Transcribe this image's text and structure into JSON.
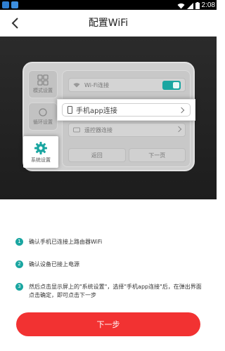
{
  "status_bar": {
    "time": "2:08"
  },
  "header": {
    "title": "配置WiFi"
  },
  "illustration": {
    "tabs": [
      {
        "label": "模式设置",
        "icon": "grid-icon"
      },
      {
        "label": "循环设置",
        "icon": "loop-icon"
      },
      {
        "label": "系统设置",
        "icon": "gear-icon"
      }
    ],
    "menu": [
      {
        "label": "Wi-Fi连接",
        "icon": "wifi-icon"
      },
      {
        "label": "手机app连接",
        "icon": "phone-icon"
      },
      {
        "label": "遥控器连接",
        "icon": "remote-icon"
      }
    ],
    "buttons": {
      "back": "返回",
      "next": "下一页"
    },
    "accent_color": "#1aa6a1"
  },
  "steps": [
    {
      "num": "1",
      "text": "确认手机已连接上路由器WiFi"
    },
    {
      "num": "2",
      "text": "确认设备已接上电源"
    },
    {
      "num": "3",
      "text": "然后点击显示屏上的\"系统设置\"，选择\"手机app连接\"后，在弹出界面点击确定，即可点击下一步"
    }
  ],
  "footer": {
    "next_label": "下一步",
    "button_color": "#f23232"
  }
}
